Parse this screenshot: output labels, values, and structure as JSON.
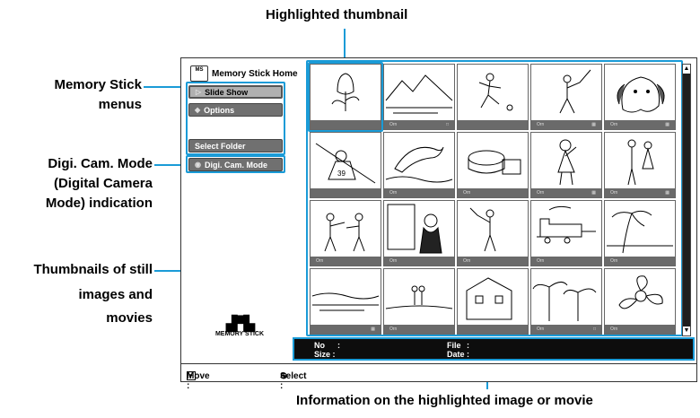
{
  "callouts": {
    "highlighted_thumbnail": "Highlighted thumbnail",
    "memory_stick_menus_1": "Memory Stick",
    "memory_stick_menus_2": "menus",
    "digi_cam_1": "Digi. Cam. Mode",
    "digi_cam_2": "(Digital Camera",
    "digi_cam_3": "Mode) indication",
    "thumbs_1": "Thumbnails of still",
    "thumbs_2": "images and",
    "thumbs_3": "movies",
    "info": "Information on the highlighted image or movie"
  },
  "sidebar": {
    "home_title": "Memory Stick Home",
    "home_icon_text": "MS",
    "slide_show": "Slide Show",
    "options": "Options",
    "select_folder": "Select Folder",
    "digi_cam_mode": "Digi. Cam. Mode",
    "logo_text": "MEMORY STICK"
  },
  "info_panel": {
    "no_label": "No",
    "size_label": "Size :",
    "file_label": "File",
    "date_label": "Date :",
    "colon": ":"
  },
  "footer": {
    "move_label": "Move :",
    "select_label": "Select :"
  },
  "thumbnails": [
    {
      "name": "tulip",
      "bar_left": "",
      "bar_right": ""
    },
    {
      "name": "mountain-lake",
      "bar_left": "Orn",
      "bar_right": "□"
    },
    {
      "name": "soccer-player",
      "bar_left": "",
      "bar_right": ""
    },
    {
      "name": "baseball-batter",
      "bar_left": "Orn",
      "bar_right": "▦"
    },
    {
      "name": "dog",
      "bar_left": "Orn",
      "bar_right": "▦"
    },
    {
      "name": "baseball-catcher",
      "bar_left": "",
      "bar_right": ""
    },
    {
      "name": "dolphin",
      "bar_left": "Orn",
      "bar_right": ""
    },
    {
      "name": "cake",
      "bar_left": "Orn",
      "bar_right": ""
    },
    {
      "name": "singer",
      "bar_left": "Orn",
      "bar_right": "▦"
    },
    {
      "name": "couple",
      "bar_left": "Orn",
      "bar_right": "▦"
    },
    {
      "name": "boxers",
      "bar_left": "Orn",
      "bar_right": ""
    },
    {
      "name": "woman-at-window",
      "bar_left": "Orn",
      "bar_right": ""
    },
    {
      "name": "golfer",
      "bar_left": "Orn",
      "bar_right": ""
    },
    {
      "name": "train",
      "bar_left": "Orn",
      "bar_right": ""
    },
    {
      "name": "palm-beach",
      "bar_left": "Orn",
      "bar_right": ""
    },
    {
      "name": "seascape",
      "bar_left": "",
      "bar_right": "▦"
    },
    {
      "name": "couple-beach",
      "bar_left": "Orn",
      "bar_right": ""
    },
    {
      "name": "building",
      "bar_left": "",
      "bar_right": ""
    },
    {
      "name": "tropical-trees",
      "bar_left": "Orn",
      "bar_right": "□"
    },
    {
      "name": "flower-closeup",
      "bar_left": "Orn",
      "bar_right": ""
    }
  ],
  "accent_color": "#1a9bd7"
}
